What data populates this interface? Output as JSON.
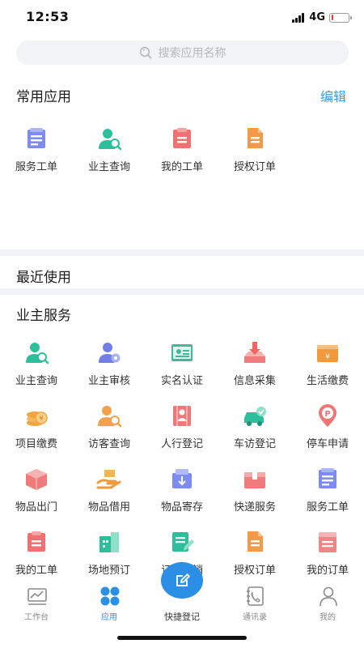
{
  "status": {
    "time": "12:53",
    "network": "4G",
    "battery_level": 0.12
  },
  "search": {
    "placeholder": "搜索应用名称"
  },
  "common_apps": {
    "title": "常用应用",
    "edit_label": "编辑",
    "items": [
      {
        "label": "服务工单",
        "icon": "service-ticket-icon"
      },
      {
        "label": "业主查询",
        "icon": "owner-search-icon"
      },
      {
        "label": "我的工单",
        "icon": "my-ticket-icon"
      },
      {
        "label": "授权订单",
        "icon": "authorized-order-icon"
      }
    ]
  },
  "recent": {
    "title": "最近使用"
  },
  "owner_services": {
    "title": "业主服务",
    "items": [
      {
        "label": "业主查询",
        "icon": "owner-search-icon"
      },
      {
        "label": "业主审核",
        "icon": "owner-review-icon"
      },
      {
        "label": "实名认证",
        "icon": "id-card-icon"
      },
      {
        "label": "信息采集",
        "icon": "info-collect-icon"
      },
      {
        "label": "生活缴费",
        "icon": "bill-payment-icon"
      },
      {
        "label": "项目缴费",
        "icon": "coins-icon"
      },
      {
        "label": "访客查询",
        "icon": "visitor-search-icon"
      },
      {
        "label": "人行登记",
        "icon": "pedestrian-register-icon"
      },
      {
        "label": "车访登记",
        "icon": "car-visit-icon"
      },
      {
        "label": "停车申请",
        "icon": "parking-pin-icon"
      },
      {
        "label": "物品出门",
        "icon": "package-out-icon"
      },
      {
        "label": "物品借用",
        "icon": "hand-borrow-icon"
      },
      {
        "label": "物品寄存",
        "icon": "storage-box-icon"
      },
      {
        "label": "快递服务",
        "icon": "express-box-icon"
      },
      {
        "label": "服务工单",
        "icon": "service-ticket-icon"
      },
      {
        "label": "我的工单",
        "icon": "my-ticket-icon"
      },
      {
        "label": "场地预订",
        "icon": "venue-building-icon"
      },
      {
        "label": "订单核销",
        "icon": "order-verify-icon"
      },
      {
        "label": "授权订单",
        "icon": "authorized-order-icon"
      },
      {
        "label": "我的订单",
        "icon": "my-order-icon"
      }
    ]
  },
  "tabbar": {
    "items": [
      {
        "label": "工作台",
        "icon": "dashboard-icon",
        "active": false
      },
      {
        "label": "应用",
        "icon": "apps-grid-icon",
        "active": true
      },
      {
        "label": "快捷登记",
        "icon": "edit-icon",
        "active": false
      },
      {
        "label": "通讯录",
        "icon": "contacts-icon",
        "active": false
      },
      {
        "label": "我的",
        "icon": "profile-icon",
        "active": false
      }
    ]
  },
  "colors": {
    "accent": "#2b8fe6",
    "edit_link": "#2f9fe8",
    "background_gap": "#f2f3f6"
  }
}
